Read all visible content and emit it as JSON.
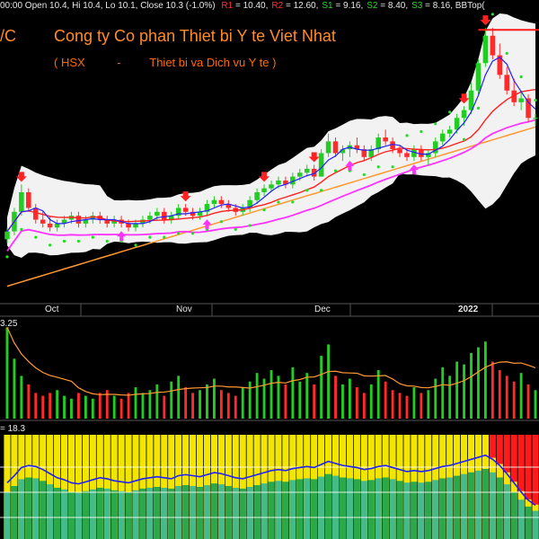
{
  "header": {
    "ohlc_text": "00:00 Open 10.4, Hi 10.4, Lo 10.1, Close 10.3 (-1.0%)",
    "levels": [
      {
        "label": "R1",
        "value": "= 10.40,",
        "color": "#ff3030"
      },
      {
        "label": "R2",
        "value": "= 12.60,",
        "color": "#ff3030"
      },
      {
        "label": "S1",
        "value": "= 9.16,",
        "color": "#22dd22"
      },
      {
        "label": "S2",
        "value": "= 8.40,",
        "color": "#22dd22"
      },
      {
        "label": "S3",
        "value": "= 8.16,",
        "color": "#22dd22"
      }
    ],
    "tail_text": "BBTop(",
    "ticker_fragment": "/C"
  },
  "title": "Cong ty Co phan Thiet bi Y te Viet Nhat",
  "subtitle": {
    "exchange": "( HSX",
    "dash": "-",
    "sector": "Thiet bi va Dich vu Y te )"
  },
  "x_labels": [
    "Oct",
    "Nov",
    "Dec",
    "2022"
  ],
  "volume_label": "3.25",
  "indicator_label": "= 18.3",
  "colors": {
    "up": "#22cc22",
    "down": "#ff2a2a",
    "bb_fill": "#ffffff",
    "ma_short": "#2020ff",
    "ma_mid": "#ff2020",
    "ma_long": "#ff33ff",
    "ma_slow": "#ff9933",
    "sar": "#22dd22",
    "buy_arrow": "#ff33ff",
    "sell_arrow": "#ff2020",
    "ind_yellow": "#f2e600",
    "ind_green": "#2aa84a",
    "ind_teal": "#44bb88",
    "ind_red": "#ff1a1a"
  },
  "chart_data": [
    {
      "type": "candlestick",
      "series": [
        {
          "name": "price",
          "values": [
            [
              7.2,
              7.5,
              7.1,
              7.4
            ],
            [
              7.4,
              8.0,
              7.3,
              7.9
            ],
            [
              7.9,
              8.6,
              7.8,
              8.4
            ],
            [
              8.4,
              8.5,
              7.9,
              8.0
            ],
            [
              8.0,
              8.1,
              7.6,
              7.7
            ],
            [
              7.7,
              7.9,
              7.5,
              7.6
            ],
            [
              7.6,
              7.8,
              7.4,
              7.5
            ],
            [
              7.5,
              7.7,
              7.4,
              7.6
            ],
            [
              7.6,
              7.8,
              7.5,
              7.7
            ],
            [
              7.7,
              7.9,
              7.6,
              7.8
            ],
            [
              7.8,
              7.9,
              7.5,
              7.6
            ],
            [
              7.6,
              7.8,
              7.5,
              7.7
            ],
            [
              7.7,
              7.9,
              7.6,
              7.8
            ],
            [
              7.8,
              7.9,
              7.6,
              7.7
            ],
            [
              7.7,
              7.8,
              7.5,
              7.6
            ],
            [
              7.6,
              7.8,
              7.5,
              7.7
            ],
            [
              7.7,
              7.8,
              7.5,
              7.6
            ],
            [
              7.6,
              7.7,
              7.4,
              7.5
            ],
            [
              7.5,
              7.7,
              7.4,
              7.6
            ],
            [
              7.6,
              7.8,
              7.5,
              7.7
            ],
            [
              7.7,
              7.9,
              7.6,
              7.8
            ],
            [
              7.8,
              8.0,
              7.7,
              7.9
            ],
            [
              7.9,
              8.0,
              7.6,
              7.7
            ],
            [
              7.7,
              7.9,
              7.6,
              7.8
            ],
            [
              7.8,
              8.1,
              7.7,
              8.0
            ],
            [
              8.0,
              8.1,
              7.8,
              7.9
            ],
            [
              7.9,
              8.0,
              7.7,
              7.8
            ],
            [
              7.8,
              8.0,
              7.7,
              7.9
            ],
            [
              7.9,
              8.2,
              7.8,
              8.1
            ],
            [
              8.1,
              8.3,
              8.0,
              8.2
            ],
            [
              8.2,
              8.3,
              8.0,
              8.1
            ],
            [
              8.1,
              8.2,
              7.9,
              8.0
            ],
            [
              8.0,
              8.1,
              7.8,
              7.9
            ],
            [
              7.9,
              8.1,
              7.8,
              8.0
            ],
            [
              8.0,
              8.3,
              7.9,
              8.2
            ],
            [
              8.2,
              8.5,
              8.1,
              8.4
            ],
            [
              8.4,
              8.6,
              8.3,
              8.5
            ],
            [
              8.5,
              8.7,
              8.4,
              8.6
            ],
            [
              8.6,
              8.8,
              8.5,
              8.7
            ],
            [
              8.7,
              8.8,
              8.5,
              8.6
            ],
            [
              8.6,
              8.9,
              8.5,
              8.8
            ],
            [
              8.8,
              9.0,
              8.7,
              8.9
            ],
            [
              8.9,
              9.1,
              8.8,
              9.0
            ],
            [
              9.0,
              9.1,
              8.7,
              8.8
            ],
            [
              8.8,
              9.5,
              8.8,
              9.4
            ],
            [
              9.4,
              9.9,
              9.3,
              9.7
            ],
            [
              9.7,
              9.8,
              9.3,
              9.4
            ],
            [
              9.4,
              9.6,
              9.2,
              9.5
            ],
            [
              9.5,
              9.7,
              9.3,
              9.6
            ],
            [
              9.6,
              9.8,
              9.4,
              9.5
            ],
            [
              9.5,
              9.6,
              9.2,
              9.3
            ],
            [
              9.3,
              9.6,
              9.2,
              9.5
            ],
            [
              9.5,
              9.9,
              9.4,
              9.8
            ],
            [
              9.8,
              10.0,
              9.6,
              9.7
            ],
            [
              9.7,
              9.8,
              9.4,
              9.5
            ],
            [
              9.5,
              9.6,
              9.3,
              9.4
            ],
            [
              9.4,
              9.5,
              9.2,
              9.3
            ],
            [
              9.3,
              9.6,
              9.2,
              9.5
            ],
            [
              9.5,
              9.6,
              9.2,
              9.3
            ],
            [
              9.3,
              9.5,
              9.1,
              9.4
            ],
            [
              9.4,
              9.8,
              9.3,
              9.7
            ],
            [
              9.7,
              10.0,
              9.6,
              9.9
            ],
            [
              9.9,
              10.1,
              9.8,
              10.0
            ],
            [
              10.0,
              10.4,
              9.9,
              10.3
            ],
            [
              10.3,
              10.6,
              10.1,
              10.5
            ],
            [
              10.5,
              11.2,
              10.4,
              11.0
            ],
            [
              11.0,
              11.8,
              10.9,
              11.7
            ],
            [
              11.7,
              12.6,
              11.6,
              12.4
            ],
            [
              12.4,
              12.6,
              11.8,
              11.9
            ],
            [
              11.9,
              12.2,
              11.3,
              11.4
            ],
            [
              11.4,
              11.6,
              10.9,
              11.0
            ],
            [
              11.0,
              11.3,
              10.6,
              10.7
            ],
            [
              10.7,
              11.0,
              10.5,
              10.8
            ],
            [
              10.8,
              10.9,
              10.2,
              10.3
            ],
            [
              10.3,
              10.4,
              10.1,
              10.3
            ]
          ]
        }
      ]
    },
    {
      "type": "bar",
      "series": [
        {
          "name": "volume",
          "values": [
            3.2,
            2.1,
            1.5,
            1.2,
            0.9,
            0.8,
            0.9,
            1.0,
            0.8,
            0.7,
            0.9,
            0.8,
            0.7,
            0.9,
            1.0,
            0.8,
            0.7,
            0.9,
            1.1,
            0.9,
            1.0,
            1.2,
            0.8,
            1.3,
            1.5,
            1.1,
            0.9,
            1.0,
            1.2,
            1.4,
            1.0,
            0.9,
            0.8,
            1.1,
            1.3,
            1.6,
            1.4,
            1.7,
            1.5,
            1.2,
            1.8,
            1.3,
            1.6,
            1.2,
            2.2,
            2.6,
            1.5,
            1.2,
            1.4,
            1.1,
            0.9,
            1.2,
            1.7,
            1.3,
            1.0,
            0.9,
            0.8,
            1.1,
            0.9,
            1.0,
            1.4,
            1.8,
            1.5,
            2.0,
            1.9,
            2.3,
            2.5,
            2.7,
            2.0,
            1.7,
            1.5,
            1.3,
            1.6,
            1.2,
            1.0
          ]
        }
      ]
    },
    {
      "type": "bar",
      "series": [
        {
          "name": "indicator",
          "values": [
            55,
            62,
            70,
            72,
            71,
            68,
            64,
            60,
            58,
            55,
            54,
            56,
            58,
            60,
            59,
            57,
            56,
            55,
            57,
            59,
            60,
            61,
            60,
            59,
            62,
            63,
            62,
            61,
            63,
            65,
            64,
            62,
            60,
            59,
            61,
            63,
            65,
            67,
            68,
            67,
            69,
            70,
            71,
            70,
            73,
            76,
            74,
            72,
            71,
            70,
            68,
            69,
            71,
            72,
            70,
            68,
            66,
            67,
            66,
            67,
            69,
            71,
            72,
            74,
            76,
            78,
            80,
            82,
            78,
            72,
            64,
            55,
            46,
            38,
            33
          ]
        }
      ]
    }
  ]
}
